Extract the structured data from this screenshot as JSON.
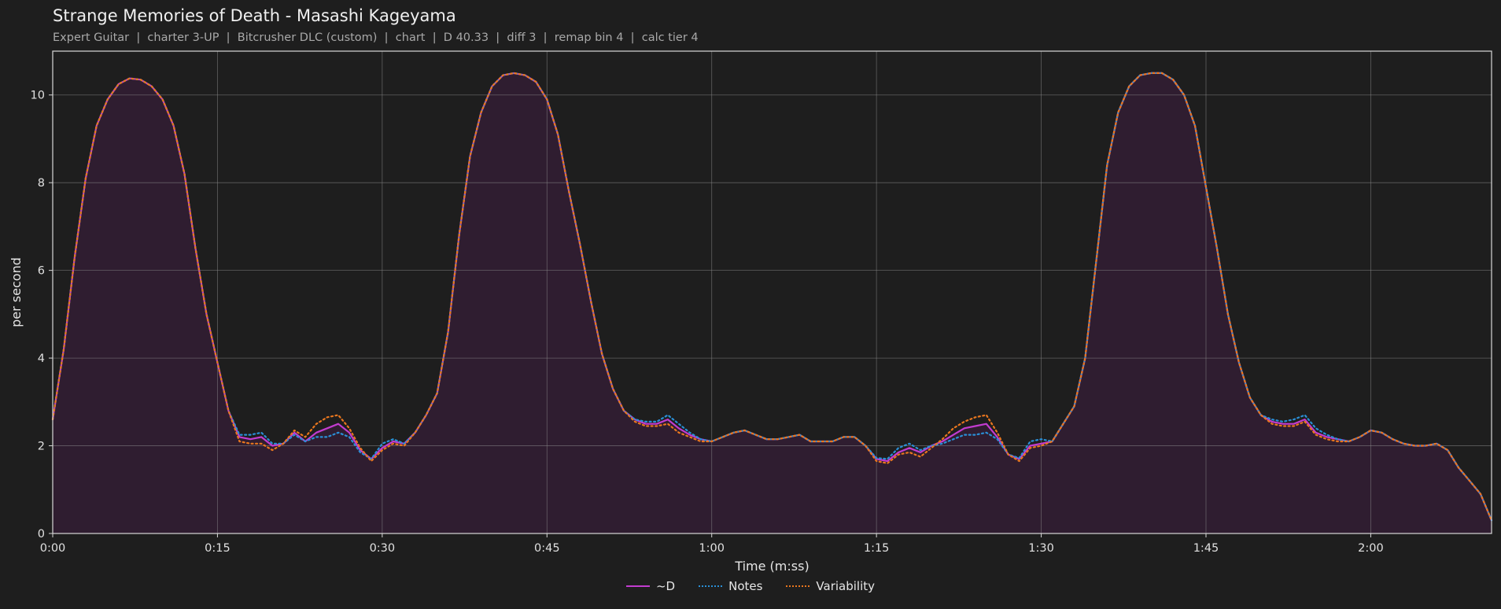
{
  "page": {
    "title": "Strange Memories of Death - Masashi Kageyama",
    "subtitle": "Expert Guitar  |  charter 3-UP  |  Bitcrusher DLC (custom)  |  chart  |  D 40.33  |  diff 3  |  remap bin 4  |  calc tier 4"
  },
  "colors": {
    "background": "#1e1e1e",
    "plot_background": "#1e1e1e",
    "fill": "#2f1d30",
    "d_line": "#c23ccf",
    "notes": "#2a8fd6",
    "variability": "#e8761e",
    "grid": "#8a8a8a",
    "axes": "#d8d8d8"
  },
  "chart_data": {
    "type": "line",
    "xlabel": "Time (m:ss)",
    "ylabel": "per second",
    "xlim": [
      0,
      131
    ],
    "ylim": [
      0,
      11
    ],
    "grid": true,
    "legend_position": "bottom-center",
    "xticks": [
      {
        "v": 0,
        "label": "0:00"
      },
      {
        "v": 15,
        "label": "0:15"
      },
      {
        "v": 30,
        "label": "0:30"
      },
      {
        "v": 45,
        "label": "0:45"
      },
      {
        "v": 60,
        "label": "1:00"
      },
      {
        "v": 75,
        "label": "1:15"
      },
      {
        "v": 90,
        "label": "1:30"
      },
      {
        "v": 105,
        "label": "1:45"
      },
      {
        "v": 120,
        "label": "2:00"
      }
    ],
    "yticks": [
      {
        "v": 0,
        "label": "0"
      },
      {
        "v": 2,
        "label": "2"
      },
      {
        "v": 4,
        "label": "4"
      },
      {
        "v": 6,
        "label": "6"
      },
      {
        "v": 8,
        "label": "8"
      },
      {
        "v": 10,
        "label": "10"
      }
    ],
    "series": [
      {
        "name": "~D",
        "style": "solid",
        "color": "#c23ccf",
        "fill": true,
        "x": [
          0,
          1,
          2,
          3,
          4,
          5,
          6,
          7,
          8,
          9,
          10,
          11,
          12,
          13,
          14,
          15,
          16,
          17,
          18,
          19,
          20,
          21,
          22,
          23,
          24,
          25,
          26,
          27,
          28,
          29,
          30,
          31,
          32,
          33,
          34,
          35,
          36,
          37,
          38,
          39,
          40,
          41,
          42,
          43,
          44,
          45,
          46,
          47,
          48,
          49,
          50,
          51,
          52,
          53,
          54,
          55,
          56,
          57,
          58,
          59,
          60,
          61,
          62,
          63,
          64,
          65,
          66,
          67,
          68,
          69,
          70,
          71,
          72,
          73,
          74,
          75,
          76,
          77,
          78,
          79,
          80,
          81,
          82,
          83,
          84,
          85,
          86,
          87,
          88,
          89,
          90,
          91,
          92,
          93,
          94,
          95,
          96,
          97,
          98,
          99,
          100,
          101,
          102,
          103,
          104,
          105,
          106,
          107,
          108,
          109,
          110,
          111,
          112,
          113,
          114,
          115,
          116,
          117,
          118,
          119,
          120,
          121,
          122,
          123,
          124,
          125,
          126,
          127,
          128,
          129,
          130,
          131
        ],
        "y": [
          2.6,
          4.2,
          6.3,
          8.1,
          9.3,
          9.9,
          10.25,
          10.38,
          10.35,
          10.2,
          9.9,
          9.3,
          8.2,
          6.5,
          5.0,
          3.9,
          2.8,
          2.2,
          2.15,
          2.2,
          2.0,
          2.05,
          2.3,
          2.1,
          2.3,
          2.4,
          2.5,
          2.3,
          1.9,
          1.7,
          1.95,
          2.1,
          2.05,
          2.3,
          2.7,
          3.2,
          4.6,
          6.8,
          8.6,
          9.6,
          10.2,
          10.45,
          10.5,
          10.45,
          10.3,
          9.9,
          9.1,
          7.8,
          6.6,
          5.3,
          4.1,
          3.3,
          2.8,
          2.6,
          2.5,
          2.5,
          2.6,
          2.4,
          2.25,
          2.15,
          2.1,
          2.2,
          2.3,
          2.35,
          2.25,
          2.15,
          2.15,
          2.2,
          2.25,
          2.1,
          2.1,
          2.1,
          2.2,
          2.2,
          2.0,
          1.7,
          1.65,
          1.85,
          1.95,
          1.85,
          2.0,
          2.1,
          2.25,
          2.4,
          2.45,
          2.5,
          2.2,
          1.8,
          1.7,
          2.0,
          2.05,
          2.1,
          2.5,
          2.9,
          4.0,
          6.2,
          8.4,
          9.6,
          10.2,
          10.45,
          10.5,
          10.5,
          10.35,
          10.0,
          9.3,
          7.9,
          6.5,
          5.0,
          3.9,
          3.1,
          2.7,
          2.55,
          2.5,
          2.5,
          2.6,
          2.3,
          2.2,
          2.15,
          2.1,
          2.2,
          2.35,
          2.3,
          2.15,
          2.05,
          2.0,
          2.0,
          2.05,
          1.9,
          1.5,
          1.2,
          0.9,
          0.3
        ]
      },
      {
        "name": "Notes",
        "style": "dotted",
        "color": "#2a8fd6",
        "x": [
          0,
          1,
          2,
          3,
          4,
          5,
          6,
          7,
          8,
          9,
          10,
          11,
          12,
          13,
          14,
          15,
          16,
          17,
          18,
          19,
          20,
          21,
          22,
          23,
          24,
          25,
          26,
          27,
          28,
          29,
          30,
          31,
          32,
          33,
          34,
          35,
          36,
          37,
          38,
          39,
          40,
          41,
          42,
          43,
          44,
          45,
          46,
          47,
          48,
          49,
          50,
          51,
          52,
          53,
          54,
          55,
          56,
          57,
          58,
          59,
          60,
          61,
          62,
          63,
          64,
          65,
          66,
          67,
          68,
          69,
          70,
          71,
          72,
          73,
          74,
          75,
          76,
          77,
          78,
          79,
          80,
          81,
          82,
          83,
          84,
          85,
          86,
          87,
          88,
          89,
          90,
          91,
          92,
          93,
          94,
          95,
          96,
          97,
          98,
          99,
          100,
          101,
          102,
          103,
          104,
          105,
          106,
          107,
          108,
          109,
          110,
          111,
          112,
          113,
          114,
          115,
          116,
          117,
          118,
          119,
          120,
          121,
          122,
          123,
          124,
          125,
          126,
          127,
          128,
          129,
          130,
          131
        ],
        "y": [
          2.6,
          4.2,
          6.3,
          8.1,
          9.3,
          9.9,
          10.25,
          10.38,
          10.35,
          10.2,
          9.9,
          9.3,
          8.2,
          6.5,
          5.0,
          3.9,
          2.8,
          2.25,
          2.25,
          2.3,
          2.05,
          2.05,
          2.25,
          2.1,
          2.2,
          2.2,
          2.3,
          2.2,
          1.85,
          1.7,
          2.05,
          2.15,
          2.05,
          2.3,
          2.7,
          3.2,
          4.6,
          6.8,
          8.6,
          9.6,
          10.2,
          10.45,
          10.5,
          10.45,
          10.3,
          9.9,
          9.1,
          7.8,
          6.6,
          5.3,
          4.1,
          3.3,
          2.8,
          2.6,
          2.55,
          2.55,
          2.7,
          2.5,
          2.3,
          2.15,
          2.1,
          2.2,
          2.3,
          2.35,
          2.25,
          2.15,
          2.15,
          2.2,
          2.25,
          2.1,
          2.1,
          2.1,
          2.2,
          2.2,
          2.0,
          1.72,
          1.7,
          1.95,
          2.05,
          1.9,
          2.0,
          2.05,
          2.15,
          2.25,
          2.25,
          2.3,
          2.15,
          1.8,
          1.72,
          2.1,
          2.15,
          2.1,
          2.5,
          2.9,
          4.0,
          6.2,
          8.4,
          9.6,
          10.2,
          10.45,
          10.5,
          10.5,
          10.35,
          10.0,
          9.3,
          7.9,
          6.5,
          5.0,
          3.9,
          3.1,
          2.7,
          2.6,
          2.55,
          2.6,
          2.7,
          2.4,
          2.25,
          2.15,
          2.1,
          2.2,
          2.35,
          2.3,
          2.15,
          2.05,
          2.0,
          2.0,
          2.05,
          1.9,
          1.5,
          1.2,
          0.9,
          0.3
        ]
      },
      {
        "name": "Variability",
        "style": "dotted",
        "color": "#e8761e",
        "x": [
          0,
          1,
          2,
          3,
          4,
          5,
          6,
          7,
          8,
          9,
          10,
          11,
          12,
          13,
          14,
          15,
          16,
          17,
          18,
          19,
          20,
          21,
          22,
          23,
          24,
          25,
          26,
          27,
          28,
          29,
          30,
          31,
          32,
          33,
          34,
          35,
          36,
          37,
          38,
          39,
          40,
          41,
          42,
          43,
          44,
          45,
          46,
          47,
          48,
          49,
          50,
          51,
          52,
          53,
          54,
          55,
          56,
          57,
          58,
          59,
          60,
          61,
          62,
          63,
          64,
          65,
          66,
          67,
          68,
          69,
          70,
          71,
          72,
          73,
          74,
          75,
          76,
          77,
          78,
          79,
          80,
          81,
          82,
          83,
          84,
          85,
          86,
          87,
          88,
          89,
          90,
          91,
          92,
          93,
          94,
          95,
          96,
          97,
          98,
          99,
          100,
          101,
          102,
          103,
          104,
          105,
          106,
          107,
          108,
          109,
          110,
          111,
          112,
          113,
          114,
          115,
          116,
          117,
          118,
          119,
          120,
          121,
          122,
          123,
          124,
          125,
          126,
          127,
          128,
          129,
          130,
          131
        ],
        "y": [
          2.6,
          4.2,
          6.3,
          8.1,
          9.3,
          9.9,
          10.25,
          10.38,
          10.35,
          10.2,
          9.9,
          9.3,
          8.2,
          6.5,
          5.0,
          3.9,
          2.8,
          2.1,
          2.05,
          2.05,
          1.9,
          2.05,
          2.35,
          2.2,
          2.5,
          2.65,
          2.7,
          2.4,
          1.95,
          1.65,
          1.9,
          2.05,
          2.0,
          2.3,
          2.7,
          3.2,
          4.6,
          6.8,
          8.6,
          9.6,
          10.2,
          10.45,
          10.5,
          10.45,
          10.3,
          9.9,
          9.1,
          7.8,
          6.6,
          5.3,
          4.1,
          3.3,
          2.8,
          2.55,
          2.45,
          2.45,
          2.5,
          2.3,
          2.2,
          2.1,
          2.1,
          2.2,
          2.3,
          2.35,
          2.25,
          2.15,
          2.15,
          2.2,
          2.25,
          2.1,
          2.1,
          2.1,
          2.2,
          2.2,
          2.0,
          1.65,
          1.6,
          1.8,
          1.85,
          1.75,
          1.95,
          2.15,
          2.4,
          2.55,
          2.65,
          2.7,
          2.3,
          1.8,
          1.65,
          1.95,
          2.0,
          2.1,
          2.5,
          2.9,
          4.0,
          6.2,
          8.4,
          9.6,
          10.2,
          10.45,
          10.5,
          10.5,
          10.35,
          10.0,
          9.3,
          7.9,
          6.5,
          5.0,
          3.9,
          3.1,
          2.7,
          2.5,
          2.45,
          2.45,
          2.55,
          2.25,
          2.15,
          2.1,
          2.1,
          2.2,
          2.35,
          2.3,
          2.15,
          2.05,
          2.0,
          2.0,
          2.05,
          1.9,
          1.5,
          1.2,
          0.9,
          0.3
        ]
      }
    ]
  }
}
